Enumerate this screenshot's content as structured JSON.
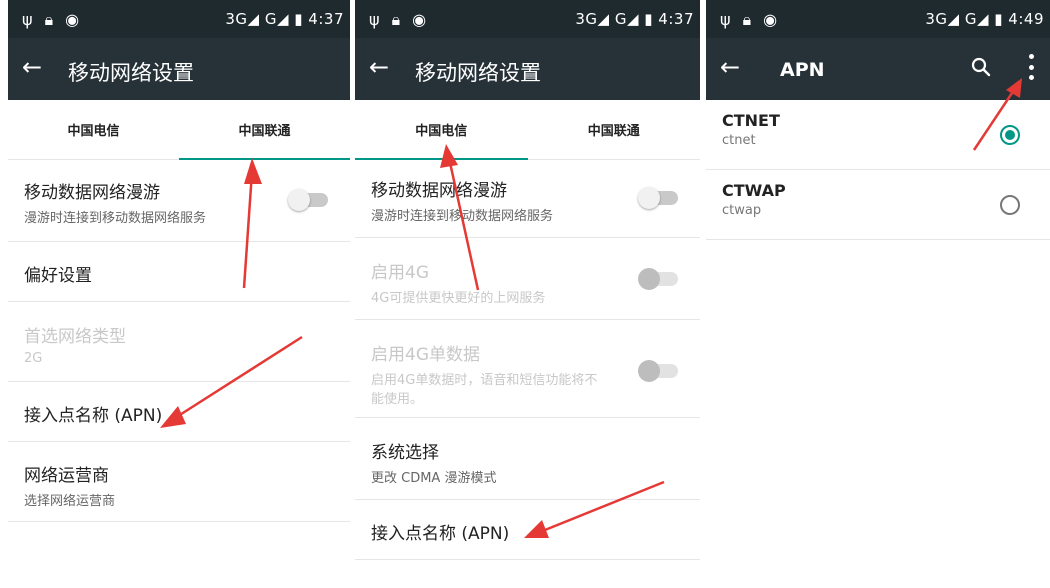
{
  "status": {
    "left_icons": [
      "usb-icon",
      "lock-icon",
      "android-icon"
    ],
    "p1_right": "3G◢ G◢ ▮ 4:37",
    "p2_right": "3G◢ G◢ ▮ 4:37",
    "p3_right": "3G◢ G◢ ▮ 4:49"
  },
  "panel1": {
    "back": "←",
    "title": "移动网络设置",
    "tabs": [
      "中国电信",
      "中国联通"
    ],
    "rows": [
      {
        "title": "移动数据网络漫游",
        "subtitle": "漫游时连接到移动数据网络服务"
      },
      {
        "title": "偏好设置"
      },
      {
        "title": "首选网络类型",
        "subtitle": "2G"
      },
      {
        "title": "接入点名称 (APN)"
      },
      {
        "title": "网络运营商",
        "subtitle": "选择网络运营商"
      }
    ]
  },
  "panel2": {
    "back": "←",
    "title": "移动网络设置",
    "tabs": [
      "中国电信",
      "中国联通"
    ],
    "rows": [
      {
        "title": "移动数据网络漫游",
        "subtitle": "漫游时连接到移动数据网络服务"
      },
      {
        "title": "启用4G",
        "subtitle": "4G可提供更快更好的上网服务"
      },
      {
        "title": "启用4G单数据",
        "subtitle": "启用4G单数据时，语音和短信功能将不能使用。"
      },
      {
        "title": "系统选择",
        "subtitle": "更改 CDMA 漫游模式"
      },
      {
        "title": "接入点名称 (APN)"
      }
    ]
  },
  "panel3": {
    "back": "←",
    "title": "APN",
    "apns": [
      {
        "name": "CTNET",
        "apn": "ctnet",
        "selected": true
      },
      {
        "name": "CTWAP",
        "apn": "ctwap",
        "selected": false
      }
    ]
  },
  "colors": {
    "appbar": "#263238",
    "statusbar": "#1f2a2f",
    "accent": "#009688",
    "annotation_arrow": "#e53935"
  }
}
